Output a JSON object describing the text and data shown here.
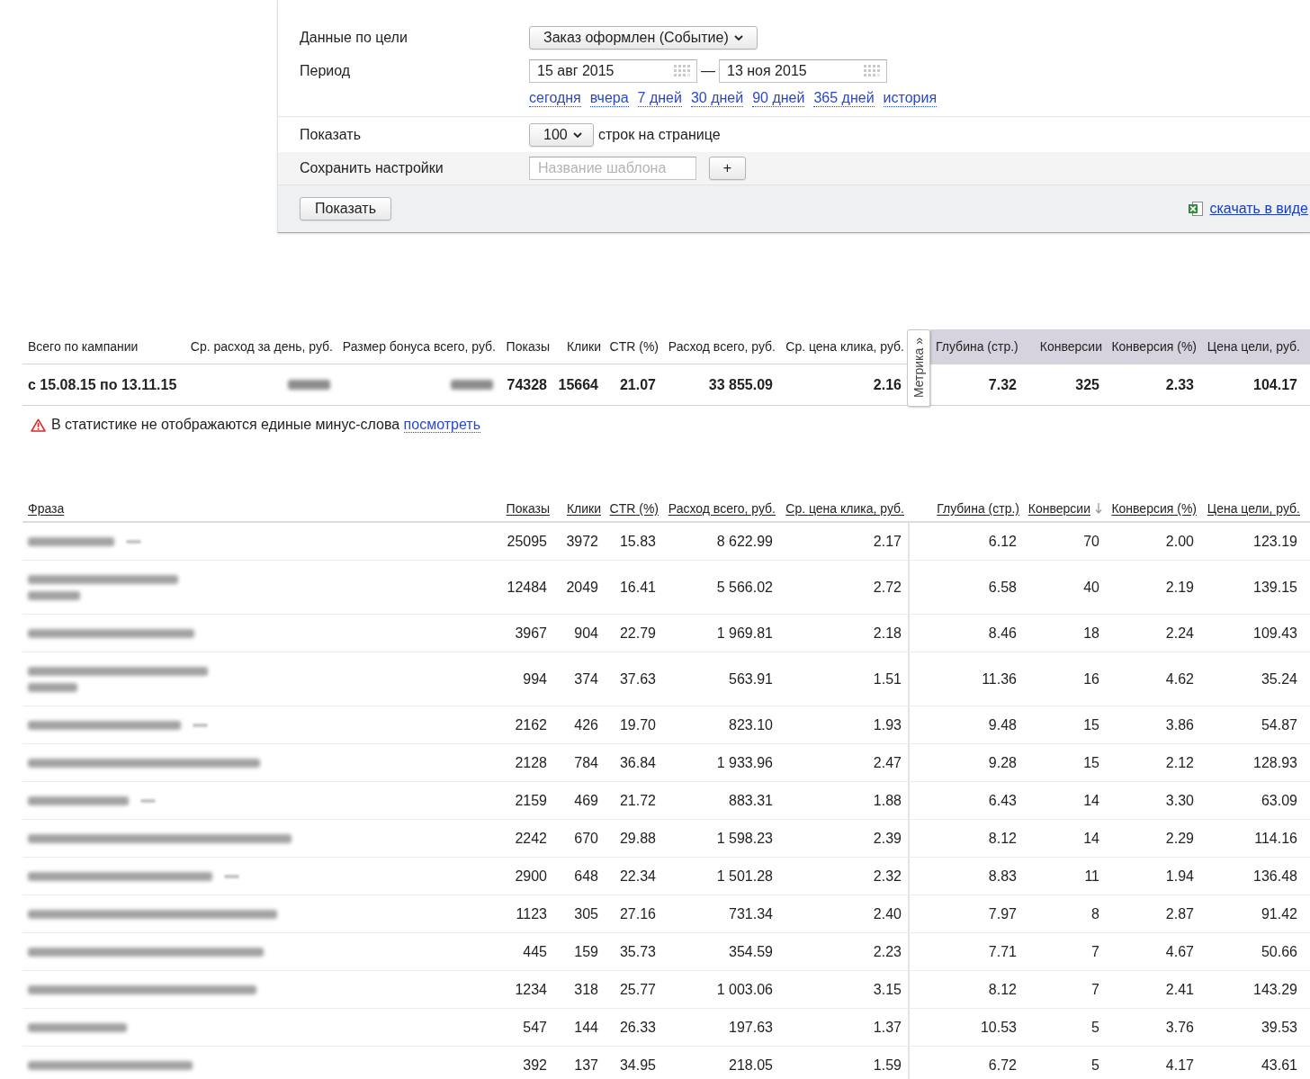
{
  "goal_form": {
    "goal_label": "Данные по цели",
    "goal_select": "Заказ оформлен (Событие)",
    "period_label": "Период",
    "date_from": "15 авг 2015",
    "date_separator": "—",
    "date_to": "13 ноя 2015",
    "quick_ranges": [
      "сегодня",
      "вчера",
      "7 дней",
      "30 дней",
      "90 дней",
      "365 дней",
      "история"
    ],
    "rows_label": "Показать",
    "rows_select": "100",
    "rows_suffix": "строк на странице",
    "save_label": "Сохранить настройки",
    "template_field": {
      "placeholder": "Название шаблона"
    },
    "add_button": "+",
    "submit_button": "Показать",
    "download_link": "скачать в виде"
  },
  "summary": {
    "direct_columns": [
      "Всего по кампании",
      "Ср. расход за день, руб.",
      "Размер бонуса всего, руб.",
      "Показы",
      "Клики",
      "CTR (%)",
      "Расход всего, руб.",
      "Ср. цена клика, руб."
    ],
    "metrika_tab": "Метрика »",
    "metrika_columns": [
      "Глубина (стр.)",
      "Конверсии",
      "Конверсия (%)",
      "Цена цели, руб."
    ],
    "direct_values": [
      {
        "kind": "text",
        "text": "с 15.08.15 по 13.11.15"
      },
      {
        "kind": "blurred"
      },
      {
        "kind": "blurred"
      },
      {
        "kind": "text",
        "text": "74328"
      },
      {
        "kind": "text",
        "text": "15664"
      },
      {
        "kind": "text",
        "text": "21.07"
      },
      {
        "kind": "text",
        "text": "33 855.09"
      },
      {
        "kind": "text",
        "text": "2.16"
      }
    ],
    "metrika_values": [
      "7.32",
      "325",
      "2.33",
      "104.17"
    ]
  },
  "warning": {
    "text": "В статистике не отображаются единые минус-слова",
    "link": "посмотреть"
  },
  "phrase_table": {
    "phrase_column": {
      "label": "Фраза",
      "sorted": false
    },
    "direct_columns": [
      {
        "label": "Показы",
        "sorted": false
      },
      {
        "label": "Клики",
        "sorted": false
      },
      {
        "label": "CTR (%)",
        "sorted": false
      },
      {
        "label": "Расход всего, руб.",
        "sorted": false
      },
      {
        "label": "Ср. цена клика, руб.",
        "sorted": false
      }
    ],
    "metrika_columns": [
      {
        "label": "Глубина (стр.)",
        "sorted": false
      },
      {
        "label": "Конверсии",
        "sorted": true
      },
      {
        "label": "Конверсия (%)",
        "sorted": false
      },
      {
        "label": "Цена цели, руб.",
        "sorted": false
      }
    ],
    "rows": [
      {
        "direct": [
          "25095",
          "3972",
          "15.83",
          "8 622.99",
          "2.17"
        ],
        "metrika": [
          "6.12",
          "70",
          "2.00",
          "123.19"
        ]
      },
      {
        "direct": [
          "12484",
          "2049",
          "16.41",
          "5 566.02",
          "2.72"
        ],
        "metrika": [
          "6.58",
          "40",
          "2.19",
          "139.15"
        ]
      },
      {
        "direct": [
          "3967",
          "904",
          "22.79",
          "1 969.81",
          "2.18"
        ],
        "metrika": [
          "8.46",
          "18",
          "2.24",
          "109.43"
        ]
      },
      {
        "direct": [
          "994",
          "374",
          "37.63",
          "563.91",
          "1.51"
        ],
        "metrika": [
          "11.36",
          "16",
          "4.62",
          "35.24"
        ]
      },
      {
        "direct": [
          "2162",
          "426",
          "19.70",
          "823.10",
          "1.93"
        ],
        "metrika": [
          "9.48",
          "15",
          "3.86",
          "54.87"
        ]
      },
      {
        "direct": [
          "2128",
          "784",
          "36.84",
          "1 933.96",
          "2.47"
        ],
        "metrika": [
          "9.28",
          "15",
          "2.12",
          "128.93"
        ]
      },
      {
        "direct": [
          "2159",
          "469",
          "21.72",
          "883.31",
          "1.88"
        ],
        "metrika": [
          "6.43",
          "14",
          "3.30",
          "63.09"
        ]
      },
      {
        "direct": [
          "2242",
          "670",
          "29.88",
          "1 598.23",
          "2.39"
        ],
        "metrika": [
          "8.12",
          "14",
          "2.29",
          "114.16"
        ]
      },
      {
        "direct": [
          "2900",
          "648",
          "22.34",
          "1 501.28",
          "2.32"
        ],
        "metrika": [
          "8.83",
          "11",
          "1.94",
          "136.48"
        ]
      },
      {
        "direct": [
          "1123",
          "305",
          "27.16",
          "731.34",
          "2.40"
        ],
        "metrika": [
          "7.97",
          "8",
          "2.87",
          "91.42"
        ]
      },
      {
        "direct": [
          "445",
          "159",
          "35.73",
          "354.59",
          "2.23"
        ],
        "metrika": [
          "7.71",
          "7",
          "4.67",
          "50.66"
        ]
      },
      {
        "direct": [
          "1234",
          "318",
          "25.77",
          "1 003.06",
          "3.15"
        ],
        "metrika": [
          "8.12",
          "7",
          "2.41",
          "143.29"
        ]
      },
      {
        "direct": [
          "547",
          "144",
          "26.33",
          "197.63",
          "1.37"
        ],
        "metrika": [
          "10.53",
          "5",
          "3.76",
          "39.53"
        ]
      },
      {
        "direct": [
          "392",
          "137",
          "34.95",
          "218.05",
          "1.59"
        ],
        "metrika": [
          "6.72",
          "5",
          "4.17",
          "43.61"
        ]
      }
    ]
  }
}
